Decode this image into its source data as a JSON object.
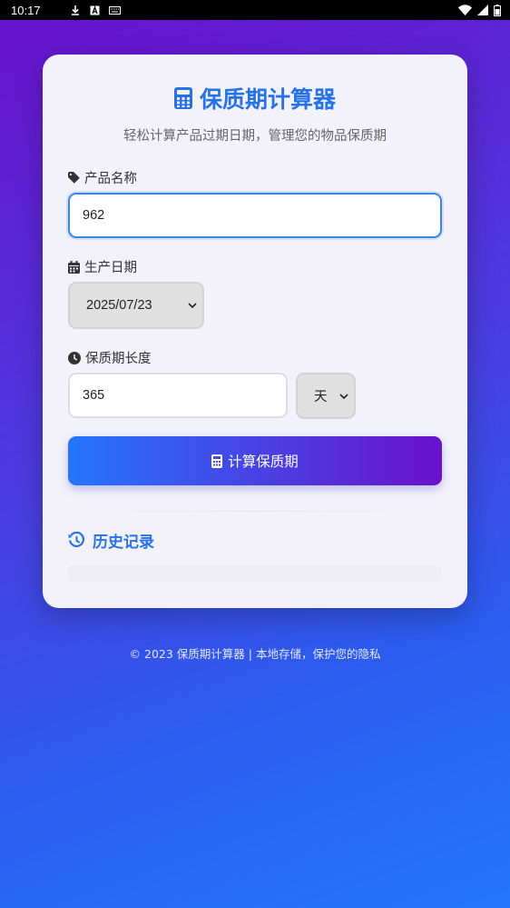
{
  "status_bar": {
    "time": "10:17",
    "left_icons": [
      "download-icon",
      "a-icon",
      "keyboard-icon"
    ],
    "right_icons": [
      "wifi-icon",
      "signal-icon",
      "battery-icon"
    ]
  },
  "header": {
    "title": "保质期计算器",
    "subtitle": "轻松计算产品过期日期，管理您的物品保质期"
  },
  "form": {
    "product_name": {
      "label": "产品名称",
      "value": "962",
      "icon": "tag-icon"
    },
    "production_date": {
      "label": "生产日期",
      "value": "2025/07/23",
      "icon": "calendar-icon"
    },
    "shelf_life": {
      "label": "保质期长度",
      "value": "365",
      "unit": "天",
      "icon": "clock-icon"
    }
  },
  "buttons": {
    "calculate_label": "计算保质期"
  },
  "history": {
    "title": "历史记录"
  },
  "footer": {
    "text": "© 2023 保质期计算器 | 本地存储，保护您的隐私"
  },
  "colors": {
    "accent": "#2872e8",
    "gradient_start": "#2575fc",
    "gradient_end": "#6a11cb",
    "card_bg": "#f3f2fb"
  }
}
